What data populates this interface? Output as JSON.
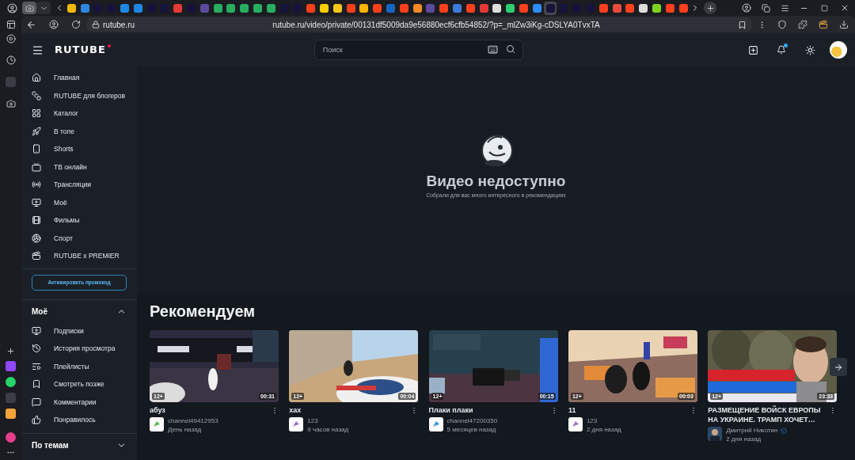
{
  "browser": {
    "tabs": [
      {
        "color": "#f5b800",
        "selected": false
      },
      {
        "color": "#2e86de",
        "selected": false
      },
      {
        "color": "#14143c",
        "selected": false
      },
      {
        "color": "#14143c",
        "selected": false
      },
      {
        "color": "#1e88e5",
        "selected": false
      },
      {
        "color": "#1e88e5",
        "selected": false
      },
      {
        "color": "#14143c",
        "selected": false
      },
      {
        "color": "#14143c",
        "selected": false
      },
      {
        "color": "#e53935",
        "selected": false
      },
      {
        "color": "#14143c",
        "selected": false
      },
      {
        "color": "#5b4a9e",
        "selected": false
      },
      {
        "color": "#27ae60",
        "selected": false
      },
      {
        "color": "#27ae60",
        "selected": false
      },
      {
        "color": "#27ae60",
        "selected": false
      },
      {
        "color": "#27ae60",
        "selected": false
      },
      {
        "color": "#27ae60",
        "selected": false
      },
      {
        "color": "#14143c",
        "selected": false
      },
      {
        "color": "#14143c",
        "selected": false
      },
      {
        "color": "#fc3f1d",
        "selected": false
      },
      {
        "color": "#ffcc00",
        "selected": false
      },
      {
        "color": "#f5c518",
        "selected": false
      },
      {
        "color": "#fc3f1d",
        "selected": false
      },
      {
        "color": "#ffb300",
        "selected": false
      },
      {
        "color": "#fc3f1d",
        "selected": false
      },
      {
        "color": "#1565c0",
        "selected": false
      },
      {
        "color": "#fc3f1d",
        "selected": false
      },
      {
        "color": "#f08a24",
        "selected": false
      },
      {
        "color": "#5b4a9e",
        "selected": false
      },
      {
        "color": "#fc3f1d",
        "selected": false
      },
      {
        "color": "#3d7bd9",
        "selected": false
      },
      {
        "color": "#fc3f1d",
        "selected": false
      },
      {
        "color": "#e53935",
        "selected": false
      },
      {
        "color": "#dddddd",
        "selected": false
      },
      {
        "color": "#2ecc71",
        "selected": false
      },
      {
        "color": "#fc3f1d",
        "selected": false
      },
      {
        "color": "#2d8cff",
        "selected": false
      },
      {
        "color": "#14143c",
        "selected": true
      },
      {
        "color": "#14143c",
        "selected": false
      },
      {
        "color": "#14143c",
        "selected": false
      },
      {
        "color": "#14143c",
        "selected": false
      },
      {
        "color": "#fc3f1d",
        "selected": false
      },
      {
        "color": "#e74c3c",
        "selected": false
      },
      {
        "color": "#fc3f1d",
        "selected": false
      },
      {
        "color": "#dddddd",
        "selected": false
      },
      {
        "color": "#7ed321",
        "selected": false
      },
      {
        "color": "#fc3f1d",
        "selected": false
      },
      {
        "color": "#fc3f1d",
        "selected": false
      }
    ],
    "address": {
      "domain": "rutube.ru",
      "url": "rutube.ru/video/private/00131df5009da9e56880ecf6cfb54852/?p=_mlZw3iKg-cDSLYA0TvxTA"
    }
  },
  "header": {
    "logo": "RUTUBE",
    "search": {
      "placeholder": "Поиск"
    },
    "notifications_unread": true
  },
  "sidebar": {
    "items": [
      {
        "label": "Главная"
      },
      {
        "label": "RUTUBE для блогеров"
      },
      {
        "label": "Каталог"
      },
      {
        "label": "В топе"
      },
      {
        "label": "Shorts"
      },
      {
        "label": "ТВ онлайн"
      },
      {
        "label": "Трансляции"
      },
      {
        "label": "Моё"
      },
      {
        "label": "Фильмы"
      },
      {
        "label": "Спорт"
      },
      {
        "label": "RUTUBE x PREMIER"
      }
    ],
    "promo_button": "Активировать промокод",
    "sections": [
      {
        "title": "Моё",
        "expanded": true,
        "items": [
          {
            "label": "Подписки"
          },
          {
            "label": "История просмотра"
          },
          {
            "label": "Плейлисты"
          },
          {
            "label": "Смотреть позже"
          },
          {
            "label": "Комментарии"
          },
          {
            "label": "Понравилось"
          }
        ]
      },
      {
        "title": "По темам",
        "expanded": false
      }
    ]
  },
  "player": {
    "title": "Видео недоступно",
    "subtitle": "Собрали для вас много интересного в рекомендациях"
  },
  "recommended": {
    "title": "Рекомендуем",
    "videos": [
      {
        "title": "абуз",
        "age": "12+",
        "duration": "00:31",
        "channel": "channel49412953",
        "date": "День назад",
        "verified": false
      },
      {
        "title": "хах",
        "age": "12+",
        "duration": "00:04",
        "channel": "123",
        "date": "9 часов назад",
        "verified": false
      },
      {
        "title": "Плаки плаки",
        "age": "12+",
        "duration": "00:15",
        "channel": "channel47200350",
        "date": "5 месяцев назад",
        "verified": false
      },
      {
        "title": "11",
        "age": "12+",
        "duration": "00:03",
        "channel": "123",
        "date": "2 дня назад",
        "verified": false
      },
      {
        "title": "РАЗМЕЩЕНИЕ ВОЙСК ЕВРОПЫ НА УКРАИНЕ. ТРАМП ХОЧЕТ…",
        "age": "12+",
        "duration": "23:33",
        "channel": "Дмитрий Никотин",
        "date": "2 дня назад",
        "verified": true
      }
    ]
  }
}
